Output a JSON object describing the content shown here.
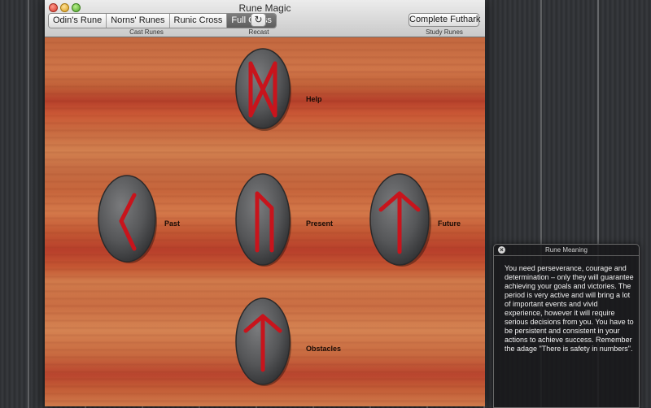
{
  "window": {
    "title": "Rune Magic"
  },
  "toolbar": {
    "cast_options": [
      "Odin's Rune",
      "Norns' Runes",
      "Runic Cross",
      "Full Cross"
    ],
    "selected_cast": "Full Cross",
    "cast_label": "Cast Runes",
    "recast_icon": "refresh-icon",
    "recast_label": "Recast",
    "study_button": "Complete Futhark",
    "study_label": "Study Runes"
  },
  "runes": {
    "help": {
      "label": "Help",
      "glyph": "mannaz"
    },
    "past": {
      "label": "Past",
      "glyph": "kenaz"
    },
    "present": {
      "label": "Present",
      "glyph": "uruz"
    },
    "future": {
      "label": "Future",
      "glyph": "tiwaz"
    },
    "obstacles": {
      "label": "Obstacles",
      "glyph": "tiwaz"
    }
  },
  "meaning_panel": {
    "title": "Rune Meaning",
    "text": "You need perseverance, courage and determination – only they will guarantee achieving your goals and victories. The period is very active and will bring a lot of important events and vivid experience, however it will require serious decisions from you. You have to be persistent and consistent in your actions to achieve success. Remember the adage \"There is safety in numbers\"."
  },
  "colors": {
    "rune_red": "#c8141c",
    "stone_grey": "#4f5052",
    "wood": "#c86a40"
  }
}
